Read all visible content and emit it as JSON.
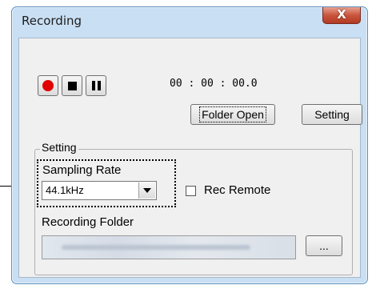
{
  "window": {
    "title": "Recording",
    "close_glyph": "X"
  },
  "transport": {
    "record_icon": "record-icon",
    "stop_icon": "stop-icon",
    "pause_icon": "pause-icon",
    "record_color": "#e00000"
  },
  "time_display": "00 : 00 : 00.0",
  "buttons": {
    "folder_open": "Folder Open",
    "setting": "Setting",
    "browse": "..."
  },
  "setting_group": {
    "legend": "Setting",
    "sampling_rate_label": "Sampling Rate",
    "sampling_rate_value": "44.1kHz",
    "rec_remote_label": "Rec Remote",
    "rec_remote_checked": false,
    "recording_folder_label": "Recording Folder"
  }
}
